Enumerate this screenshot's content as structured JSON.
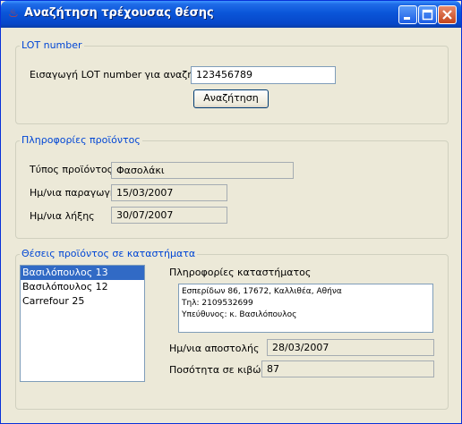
{
  "window": {
    "title": "Αναζήτηση τρέχουσας θέσης",
    "icon": "java-cup-icon"
  },
  "lot_group": {
    "title": "LOT number",
    "search_label": "Εισαγωγή LOT number για αναζήτηση",
    "lot_value": "123456789",
    "search_button": "Αναζήτηση"
  },
  "product_group": {
    "title": "Πληροφορίες προϊόντος",
    "type_label": "Τύπος προϊόντος",
    "type_value": "Φασολάκι",
    "production_label": "Ημ/νια παραγωγής",
    "production_value": "15/03/2007",
    "expiry_label": "Ημ/νια λήξης",
    "expiry_value": "30/07/2007"
  },
  "stores_group": {
    "title": "Θέσεις προϊόντος σε καταστήματα",
    "stores": [
      "Βασιλόπουλος 13",
      "Βασιλόπουλος 12",
      "Carrefour 25"
    ],
    "selected_index": 0,
    "store_info_label": "Πληροφορίες καταστήματος",
    "store_info_lines": [
      "Εσπερίδων 86, 17672, Καλλιθέα, Αθήνα",
      "Τηλ: 2109532699",
      "Υπεύθυνος: κ. Βασιλόπουλος"
    ],
    "shipping_label": "Ημ/νια αποστολής",
    "shipping_value": "28/03/2007",
    "quantity_label": "Ποσότητα σε κιβώτια",
    "quantity_value": "87"
  }
}
